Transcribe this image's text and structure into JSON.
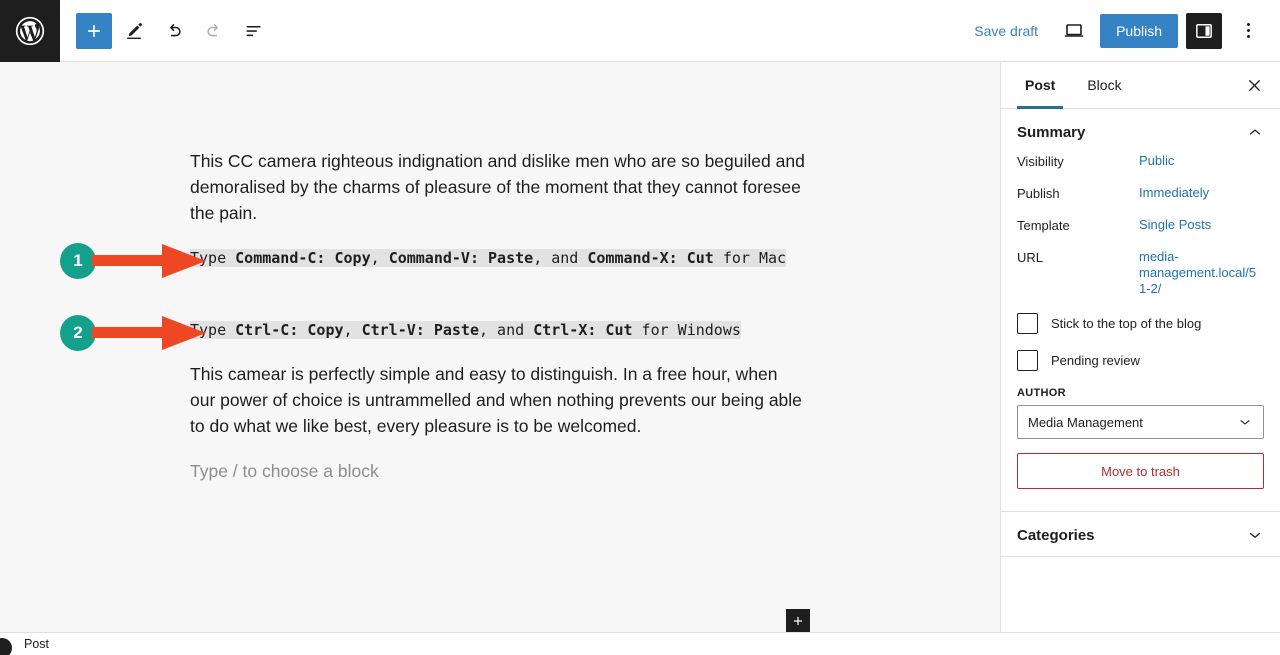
{
  "toolbar": {
    "logo_icon": "wordpress-logo-icon",
    "add_block_label": "+",
    "add_block_icon": "plus-icon",
    "tools_icon": "pencil-icon",
    "undo_icon": "undo-arrow-icon",
    "redo_icon": "redo-arrow-icon",
    "list_view_icon": "document-overview-icon",
    "save_draft_label": "Save draft",
    "preview_icon": "laptop-preview-icon",
    "publish_label": "Publish",
    "settings_icon": "sidebar-toggle-icon",
    "options_icon": "kebab-menu-icon",
    "accent_blue": "#3582c4"
  },
  "editor": {
    "paragraph_1": "This CC camera righteous indignation and dislike men who are so beguiled and demoralised by the charms of pleasure of the moment that they cannot foresee the pain.",
    "code_line_1": {
      "prefix": "Type ",
      "keys_1": "Command-C: Copy",
      "sep_1": ", ",
      "keys_2": "Command-V: Paste",
      "sep_2": ", and ",
      "keys_3": "Command-X: Cut",
      "suffix": " for Mac"
    },
    "code_line_2": {
      "prefix": "Type ",
      "keys_1": "Ctrl-C: Copy",
      "sep_1": ", ",
      "keys_2": "Ctrl-V: Paste",
      "sep_2": ", and ",
      "keys_3": "Ctrl-X: Cut",
      "suffix": " for Windows"
    },
    "paragraph_3": "This camear is perfectly simple and easy to distinguish. In a free hour, when our power of choice is untrammelled and when nothing prevents our being able to do what we like best, every pleasure is to be welcomed.",
    "placeholder": "Type / to choose a block",
    "inserter_label": "+",
    "highlight_color": "#e2e2e2"
  },
  "annotations": {
    "circle_color": "#13a08c",
    "arrow_color": "#ee4724",
    "markers": [
      {
        "number": "1",
        "icon": "arrow-right-icon"
      },
      {
        "number": "2",
        "icon": "arrow-right-icon"
      }
    ]
  },
  "sidebar": {
    "tabs": [
      {
        "label": "Post",
        "active": true
      },
      {
        "label": "Block",
        "active": false
      }
    ],
    "close_icon": "close-icon",
    "summary": {
      "title": "Summary",
      "collapse_icon": "chevron-up-icon",
      "rows": [
        {
          "label": "Visibility",
          "value": "Public"
        },
        {
          "label": "Publish",
          "value": "Immediately"
        },
        {
          "label": "Template",
          "value": "Single Posts"
        },
        {
          "label": "URL",
          "value": "media-management.local/51-2/"
        }
      ],
      "checkboxes": [
        {
          "label": "Stick to the top of the blog",
          "checked": false
        },
        {
          "label": "Pending review",
          "checked": false
        }
      ],
      "author_label": "AUTHOR",
      "author_value": "Media Management",
      "author_chevron_icon": "chevron-down-icon",
      "trash_label": "Move to trash"
    },
    "categories": {
      "title": "Categories",
      "expand_icon": "chevron-down-icon"
    }
  },
  "statusbar": {
    "breadcrumb": "Post"
  }
}
